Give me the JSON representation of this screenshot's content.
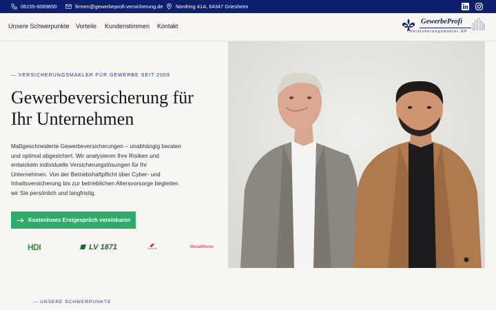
{
  "topbar": {
    "phone": "06155-6069650",
    "email": "firmen@gewerbeprofi-versicherung.de",
    "address": "Nordring 41A, 64347 Griesheim",
    "social": [
      "linkedin-icon",
      "instagram-icon"
    ]
  },
  "nav": {
    "items": [
      "Unsere Schwerpunkte",
      "Vorteile",
      "Kundenstimmen",
      "Kontakt"
    ]
  },
  "logo": {
    "name": "GewerbeProfi",
    "subtitle": "Versicherungsmakler GP"
  },
  "hero": {
    "eyebrow": "— VERSICHERUNGSMAKLER FÜR GEWERBE SEIT 2009",
    "title_line1": "Gewerbeversicherung für",
    "title_line2": "Ihr Unternehmen",
    "text": "Maßgeschneiderte Gewerbeversicherungen – unabhängig beraten und optimal abgesichert. Wir analysieren Ihre Risiken und entwickeln individuelle Versicherungslösungen für Ihr Unternehmen. Von der Betriebshaftpflicht über Cyber- und Inhaltsversicherung bis zur betrieblichen Altersvorsorge begleiten wir Sie persönlich und langfristig.",
    "cta": "Kostenloses Erstgespräch vereinbaren"
  },
  "partners": {
    "hdi": "HDI",
    "lv": "LV 1871",
    "swiss": "SwissLife",
    "metall": "MetallRente"
  },
  "section": {
    "eyebrow": "— UNSERE SCHWERPUNKTE"
  },
  "colors": {
    "brand": "#0e1f6e",
    "cta": "#2faa6a",
    "background": "#f7f6f2"
  }
}
